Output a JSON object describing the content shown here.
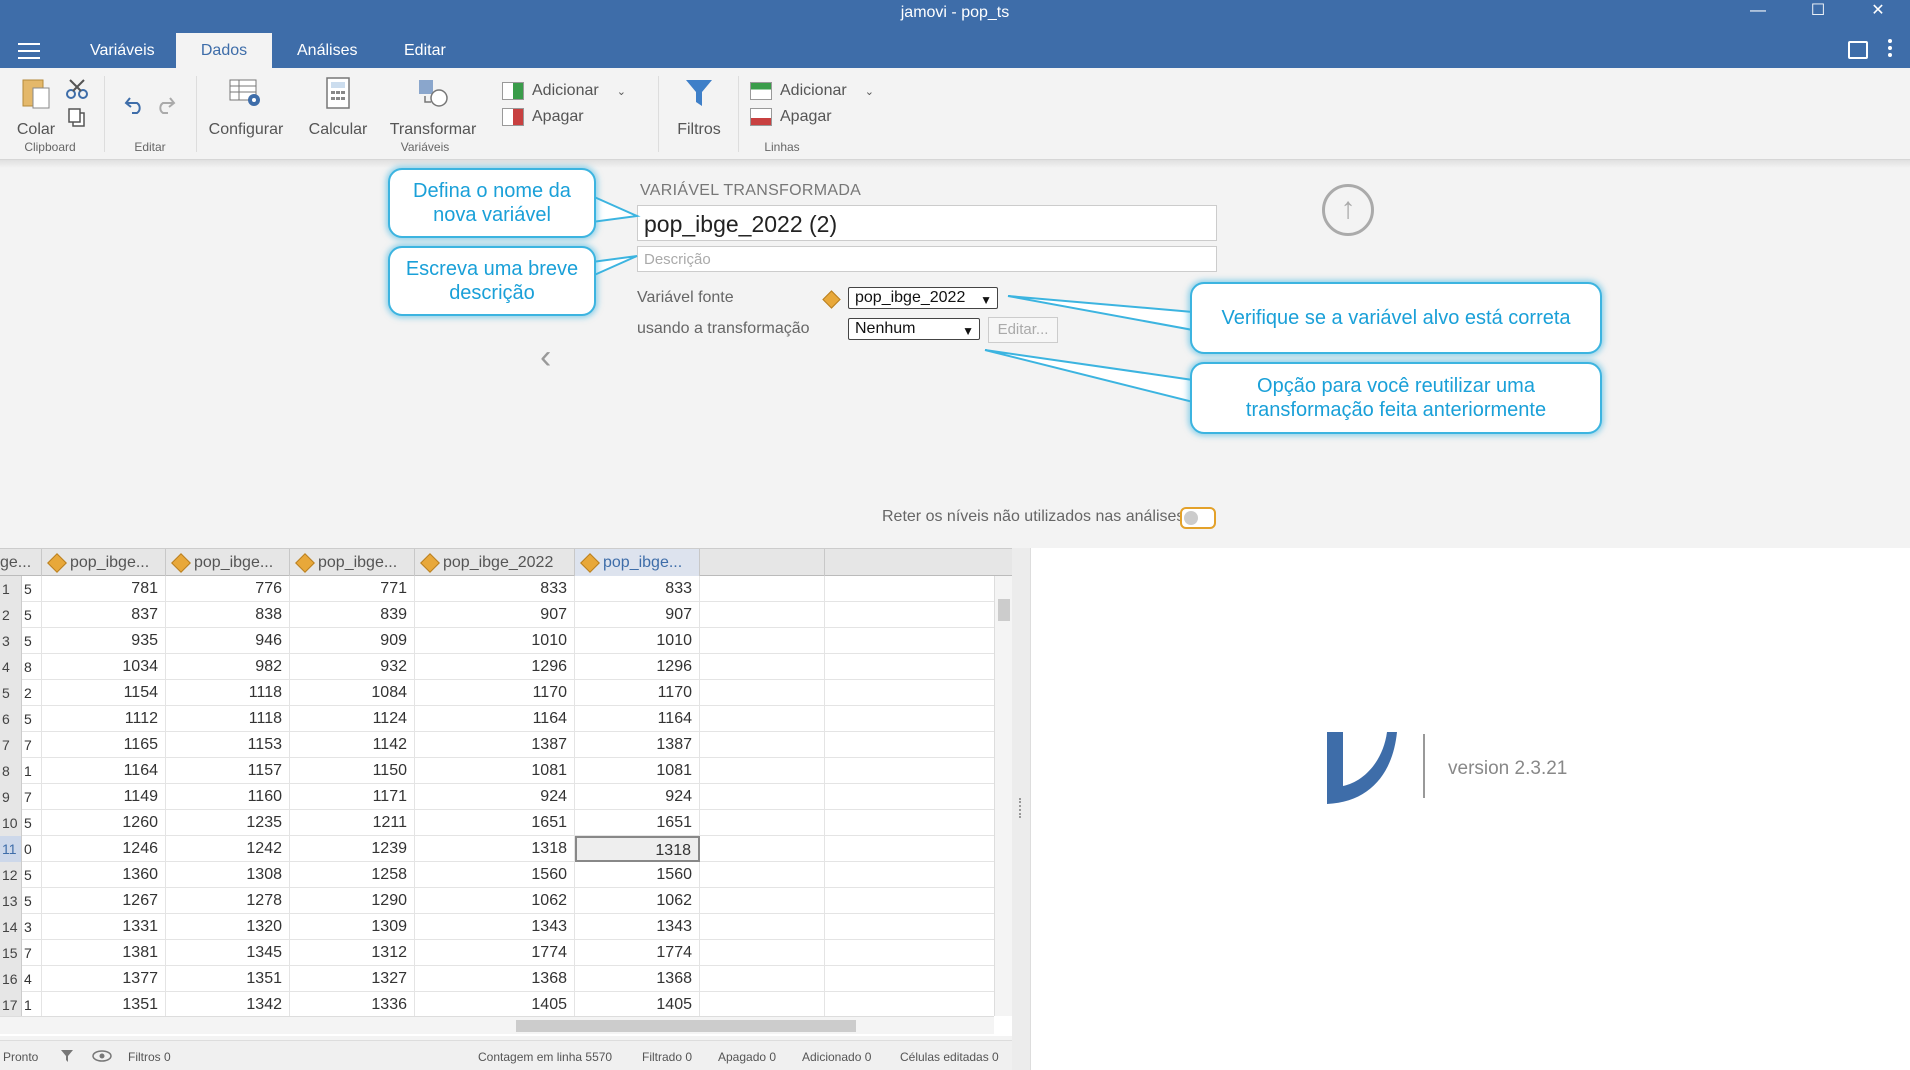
{
  "window": {
    "title": "jamovi - pop_ts",
    "minimize": "—",
    "maximize": "☐",
    "close": "✕"
  },
  "menu": {
    "tabs": [
      "Variáveis",
      "Dados",
      "Análises",
      "Editar"
    ],
    "active": "Dados"
  },
  "ribbon": {
    "paste": "Colar",
    "clipboard_group": "Clipboard",
    "edit_group": "Editar",
    "setup": "Configurar",
    "compute": "Calcular",
    "transform": "Transformar",
    "variables_group": "Variáveis",
    "var_add": "Adicionar",
    "var_delete": "Apagar",
    "filters": "Filtros",
    "row_add": "Adicionar",
    "row_delete": "Apagar",
    "rows_group": "Linhas"
  },
  "setup": {
    "section_label": "VARIÁVEL TRANSFORMADA",
    "name_value": "pop_ibge_2022 (2)",
    "description_placeholder": "Descrição",
    "source_label": "Variável fonte",
    "source_value": "pop_ibge_2022",
    "transform_label": "usando a transformação",
    "transform_value": "Nenhum",
    "edit_button": "Editar...",
    "retain_label": "Reter os níveis não utilizados nas análises",
    "retain_on": false
  },
  "callouts": {
    "name": "Defina o nome da nova variável",
    "description": "Escreva uma breve descrição",
    "target": "Verifique se a variável alvo está correta",
    "reuse": "Opção para você reutilizar uma transformação feita anteriormente"
  },
  "sheet": {
    "columns": [
      "ge...",
      "pop_ibge...",
      "pop_ibge...",
      "pop_ibge...",
      "pop_ibge_2022",
      "pop_ibge..."
    ],
    "rows": [
      [
        "1",
        "5",
        "781",
        "776",
        "771",
        "833",
        "833"
      ],
      [
        "2",
        "5",
        "837",
        "838",
        "839",
        "907",
        "907"
      ],
      [
        "3",
        "5",
        "935",
        "946",
        "909",
        "1010",
        "1010"
      ],
      [
        "4",
        "8",
        "1034",
        "982",
        "932",
        "1296",
        "1296"
      ],
      [
        "5",
        "2",
        "1154",
        "1118",
        "1084",
        "1170",
        "1170"
      ],
      [
        "6",
        "5",
        "1112",
        "1118",
        "1124",
        "1164",
        "1164"
      ],
      [
        "7",
        "7",
        "1165",
        "1153",
        "1142",
        "1387",
        "1387"
      ],
      [
        "8",
        "1",
        "1164",
        "1157",
        "1150",
        "1081",
        "1081"
      ],
      [
        "9",
        "7",
        "1149",
        "1160",
        "1171",
        "924",
        "924"
      ],
      [
        "10",
        "5",
        "1260",
        "1235",
        "1211",
        "1651",
        "1651"
      ],
      [
        "11",
        "0",
        "1246",
        "1242",
        "1239",
        "1318",
        "1318"
      ],
      [
        "12",
        "5",
        "1360",
        "1308",
        "1258",
        "1560",
        "1560"
      ],
      [
        "13",
        "5",
        "1267",
        "1278",
        "1290",
        "1062",
        "1062"
      ],
      [
        "14",
        "3",
        "1331",
        "1320",
        "1309",
        "1343",
        "1343"
      ],
      [
        "15",
        "7",
        "1381",
        "1345",
        "1312",
        "1774",
        "1774"
      ],
      [
        "16",
        "4",
        "1377",
        "1351",
        "1327",
        "1368",
        "1368"
      ],
      [
        "17",
        "1",
        "1351",
        "1342",
        "1336",
        "1405",
        "1405"
      ]
    ]
  },
  "status": {
    "ready": "Pronto",
    "filters": "Filtros 0",
    "row_count": "Contagem em linha 5570",
    "filtered": "Filtrado 0",
    "deleted": "Apagado 0",
    "added": "Adicionado 0",
    "edited": "Células editadas 0"
  },
  "results": {
    "version": "version 2.3.21"
  },
  "colors": {
    "brand": "#3e6da9",
    "callout": "#1aa0d8",
    "accent_orange": "#e3a12a"
  }
}
